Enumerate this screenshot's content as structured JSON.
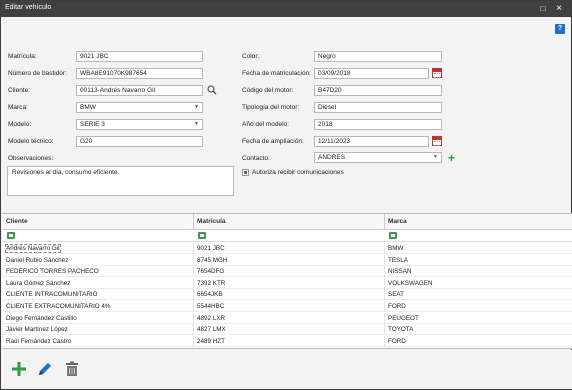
{
  "window": {
    "title": "Editar vehículo",
    "maximize_glyph": "□",
    "close_glyph": "×",
    "help_glyph": "?"
  },
  "form": {
    "matricula": {
      "label": "Matrícula:",
      "value": "9021 JBC"
    },
    "bastidor": {
      "label": "Número de bastidor:",
      "value": "WBA8E91070K987654"
    },
    "cliente": {
      "label": "Cliente:",
      "value": "00113-Andrés Navarro Gil"
    },
    "marca": {
      "label": "Marca:",
      "value": "BMW"
    },
    "modelo": {
      "label": "Modelo:",
      "value": "SERIE 3"
    },
    "modelo_tecnico": {
      "label": "Modelo técnico:",
      "value": "G20"
    },
    "observaciones": {
      "label": "Observaciones:",
      "value": "Revisiones al día, consumo eficiente."
    },
    "color": {
      "label": "Color:",
      "value": "Negro"
    },
    "fecha_matriculacion": {
      "label": "Fecha de matriculación:",
      "value": "03/09/2018"
    },
    "codigo_motor": {
      "label": "Código del motor:",
      "value": "B47D20"
    },
    "tipologia_motor": {
      "label": "Tipología del motor:",
      "value": "Diésel"
    },
    "anio_modelo": {
      "label": "Año del modelo:",
      "value": "2018"
    },
    "fecha_ampliacion": {
      "label": "Fecha de ampliación:",
      "value": "12/11/2023"
    },
    "contacto": {
      "label": "Contacto:",
      "value": "ANDRES"
    },
    "autoriza": {
      "label": "Autoriza recibir comunicaciones"
    }
  },
  "grid": {
    "columns": [
      "Cliente",
      "Matrícula",
      "Marca"
    ],
    "rows": [
      [
        "Andrés Navarro Gil",
        "9021 JBC",
        "BMW"
      ],
      [
        "Daniel Rubio Sánchez",
        "8745 MGH",
        "TESLA"
      ],
      [
        "FEDERICO TORRES PACHECO",
        "7654DFG",
        "NISSAN"
      ],
      [
        "Laura Gómez Sánchez",
        "7392 KTR",
        "VOLKSWAGEN"
      ],
      [
        "CLIENTE INTRACOMUNITARIO",
        "6654JKB",
        "SEAT"
      ],
      [
        "CLIENTE EXTRACOMUNITARIO 4%",
        "5544HBC",
        "FORD"
      ],
      [
        "Diego Fernández Castillo",
        "4892 LXR",
        "PEUGEOT"
      ],
      [
        "Javier Martínez López",
        "4827 LMX",
        "TOYOTA"
      ],
      [
        "Raúl Fernández Castro",
        "2489 HZT",
        "FORD"
      ]
    ]
  },
  "toolbar": {
    "icons": [
      "add-icon",
      "edit-icon",
      "delete-icon"
    ]
  },
  "colors": {
    "titlebar": "#404040",
    "accent_green": "#2e9e3e",
    "accent_blue": "#1e6fcf",
    "calendar_red": "#c9302c"
  }
}
